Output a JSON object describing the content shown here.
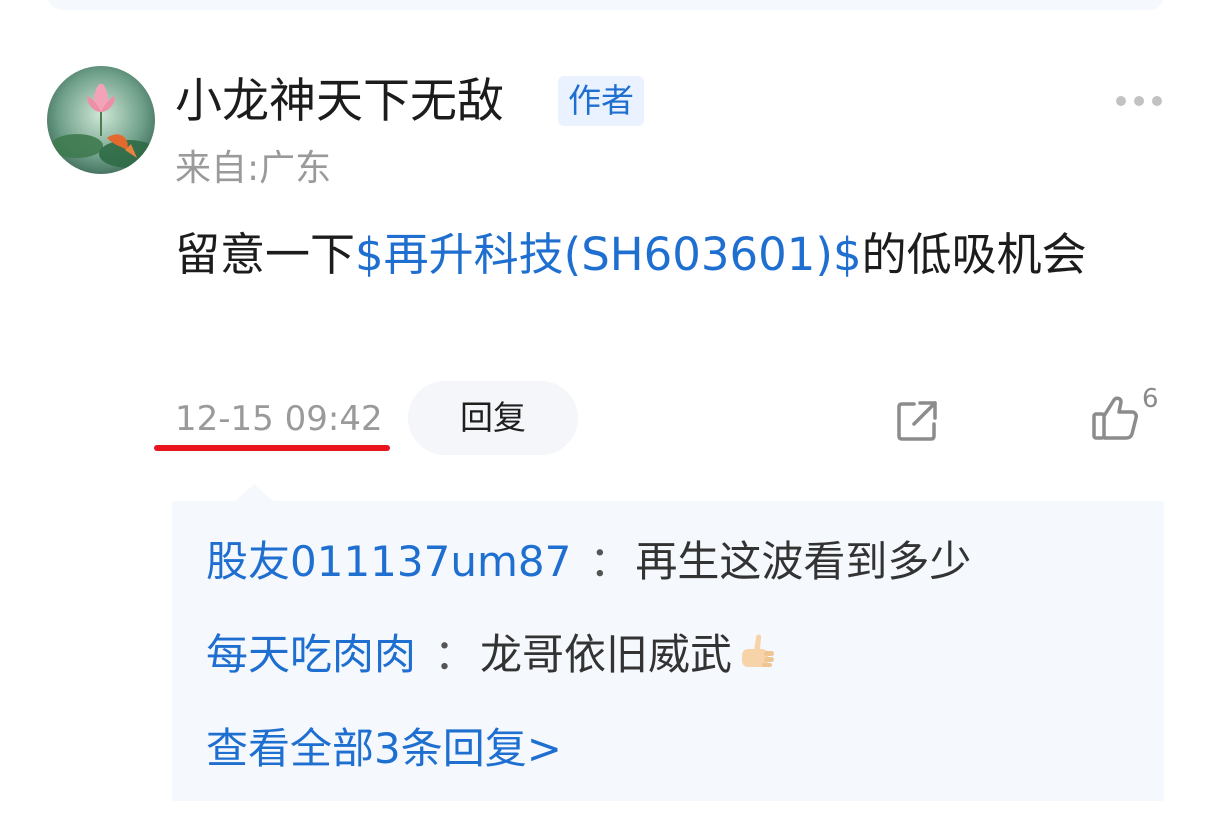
{
  "post": {
    "username": "小龙神天下无敌",
    "badge": "作者",
    "location": "来自:广东",
    "text_before": "留意一下",
    "stock_link": "$再升科技(SH603601)$",
    "text_after": "的低吸机会",
    "timestamp": "12-15 09:42",
    "reply_button": "回复",
    "like_count": "6"
  },
  "replies": [
    {
      "author": "股友011137um87",
      "separator": "：",
      "content": "再生这波看到多少"
    },
    {
      "author": "每天吃肉肉",
      "separator": "：",
      "content": "龙哥依旧威武"
    }
  ],
  "view_all": "查看全部3条回复>",
  "icons": {
    "more": "more-dots-icon",
    "share": "share-icon",
    "like": "thumbs-up-icon",
    "emoji": "thumbs-up-emoji-icon"
  },
  "colors": {
    "link_blue": "#1f6fd1",
    "badge_bg": "#e9f2fe",
    "muted_gray": "#9a9a9a",
    "reply_bg": "#f5f8fd",
    "underline_red": "#e8131c"
  }
}
